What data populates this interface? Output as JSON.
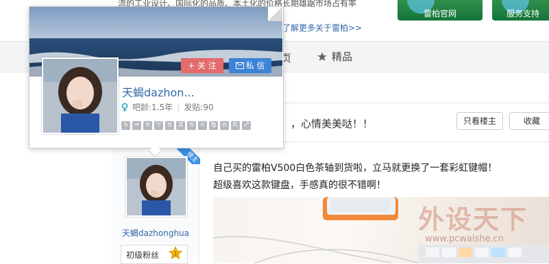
{
  "header": {
    "description": "流的工业设计、国际化的品质、本土化的价格长期雄踞市场占有率",
    "learn_more": "了解更多关于雷柏>>",
    "banners": [
      {
        "label": "雷柏官网"
      },
      {
        "label": "服务支持"
      }
    ]
  },
  "tabs": {
    "partial_label": "页",
    "featured_label": "精品",
    "featured_icon": "star-icon"
  },
  "thread": {
    "title_tail": "，心情美美哒！！",
    "only_host_label": "只看楼主",
    "collect_label": "收藏"
  },
  "author": {
    "badge": "楼主",
    "name": "天蝎dazhonghua",
    "fan_level": "初级粉丝",
    "fan_level_number": "1"
  },
  "post": {
    "line1": "自己买的雷柏V500白色茶轴到货啦，立马就更换了一套彩虹键帽！",
    "line2": "超级喜欢这款键盘，手感真的很不错啊！",
    "watermark_main": "外设天下",
    "watermark_url": "www.pcwaishe.cn"
  },
  "popup": {
    "name": "天蝎dazhon...",
    "follow_label": "+ 关 注",
    "message_label": "私 信",
    "tenure_label": "吧龄:1.5年",
    "posts_label": "发贴:90",
    "zodiac": [
      "♑",
      "♒",
      "♓",
      "♈",
      "♉",
      "♊",
      "♋",
      "♌",
      "♍",
      "♎",
      "♏",
      "♐"
    ],
    "colors": {
      "follow": "#e36b6b",
      "message": "#3d83d6",
      "link": "#3366aa"
    }
  }
}
